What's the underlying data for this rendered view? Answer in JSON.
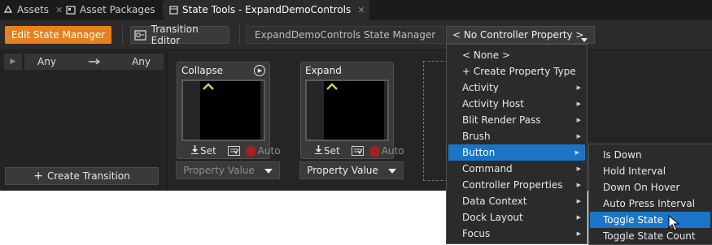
{
  "tabs": [
    {
      "label": "Assets",
      "icon": "assets-icon",
      "close": "✕"
    },
    {
      "label": "Asset Packages",
      "icon": "asset-packages-icon",
      "close": "✕"
    },
    {
      "label": "State Tools - ExpandDemoControls",
      "icon": "state-tools-icon",
      "close": "✕",
      "active": true
    }
  ],
  "toolbar": {
    "edit_state_manager": "Edit State Manager",
    "transition_editor": "Transition Editor",
    "state_manager_name": "ExpandDemoControls State Manager",
    "controller_property": "< No Controller Property >"
  },
  "left_panel": {
    "any_from": "Any",
    "any_to": "Any",
    "create_transition": "Create Transition"
  },
  "states": [
    {
      "title": "Collapse",
      "set": "Set",
      "auto": "Auto",
      "property": "Property Value",
      "property_dim": true
    },
    {
      "title": "Expand",
      "set": "Set",
      "auto": "Auto",
      "property": "Property Value",
      "property_dim": false
    }
  ],
  "menu": {
    "items": [
      {
        "label": "< None >",
        "submenu": false
      },
      {
        "label": "+ Create Property Type",
        "submenu": false
      },
      {
        "label": "Activity",
        "submenu": true
      },
      {
        "label": "Activity Host",
        "submenu": true
      },
      {
        "label": "Blit Render Pass",
        "submenu": true
      },
      {
        "label": "Brush",
        "submenu": true
      },
      {
        "label": "Button",
        "submenu": true,
        "highlighted": true
      },
      {
        "label": "Command",
        "submenu": true
      },
      {
        "label": "Controller Properties",
        "submenu": true
      },
      {
        "label": "Data Context",
        "submenu": true
      },
      {
        "label": "Dock Layout",
        "submenu": true
      },
      {
        "label": "Focus",
        "submenu": true
      }
    ]
  },
  "submenu": {
    "items": [
      {
        "label": "Is Down"
      },
      {
        "label": "Hold Interval"
      },
      {
        "label": "Down On Hover"
      },
      {
        "label": "Auto Press Interval"
      },
      {
        "label": "Toggle State",
        "highlighted": true
      },
      {
        "label": "Toggle State Count"
      }
    ]
  },
  "colors": {
    "accent_orange": "#e8801e",
    "highlight_blue": "#1a75c6",
    "record_red": "#a72020",
    "chevron_green": "#c5d93a"
  }
}
